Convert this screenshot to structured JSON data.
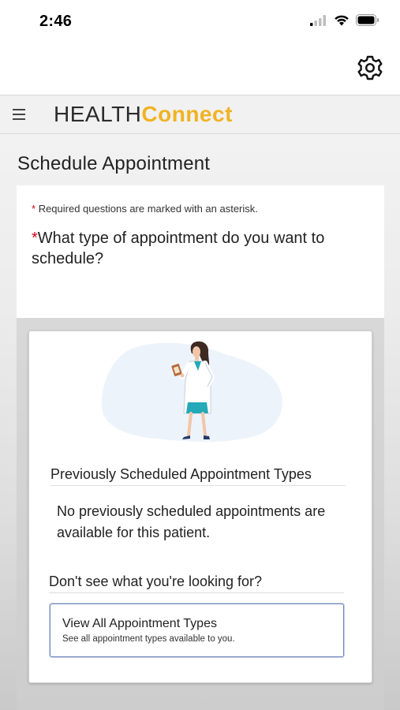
{
  "status_bar": {
    "time": "2:46",
    "icons": [
      "signal-icon",
      "wifi-icon",
      "battery-icon"
    ]
  },
  "toolbar": {
    "settings_icon": "gear-icon"
  },
  "header": {
    "menu_icon": "hamburger-menu-icon",
    "logo_part1": "HEALTH",
    "logo_part2": "Connect"
  },
  "page": {
    "title": "Schedule Appointment",
    "required_note": "Required questions are marked with an asterisk.",
    "asterisk": "*",
    "question": "What type of appointment do you want to schedule?"
  },
  "previous": {
    "heading": "Previously Scheduled Appointment Types",
    "empty_message": "No previously scheduled appointments are available for this patient."
  },
  "more": {
    "heading": "Don't see what you're looking for?",
    "button_title": "View All Appointment Types",
    "button_subtitle": "See all appointment types available to you."
  },
  "colors": {
    "brand_accent": "#f0b323",
    "required_red": "#d0021b",
    "button_border": "#6d86b8"
  }
}
